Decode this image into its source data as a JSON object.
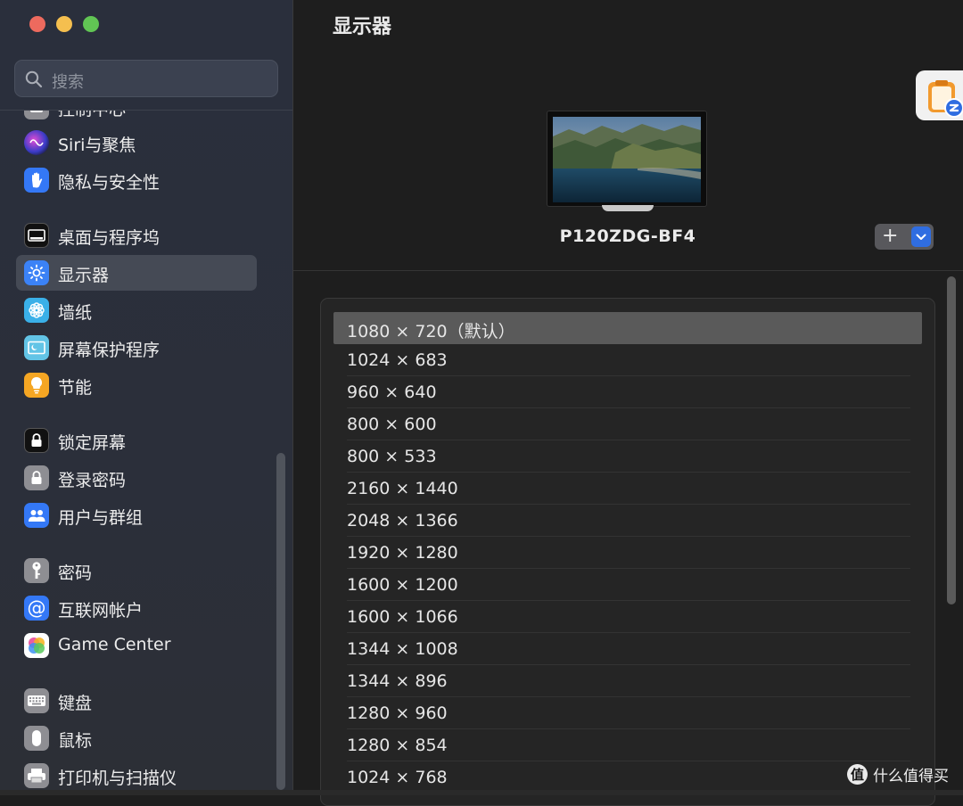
{
  "search": {
    "placeholder": "搜索"
  },
  "sidebar": {
    "items": [
      {
        "label": "控制中心",
        "icon": "control-center-icon"
      },
      {
        "label": "Siri与聚焦",
        "icon": "siri-icon"
      },
      {
        "label": "隐私与安全性",
        "icon": "hand-icon"
      },
      {
        "label": "桌面与程序坞",
        "icon": "dock-icon"
      },
      {
        "label": "显示器",
        "icon": "sun-icon",
        "selected": true
      },
      {
        "label": "墙纸",
        "icon": "flower-icon"
      },
      {
        "label": "屏幕保护程序",
        "icon": "screensaver-icon"
      },
      {
        "label": "节能",
        "icon": "lightbulb-icon"
      },
      {
        "label": "锁定屏幕",
        "icon": "lock-screen-icon"
      },
      {
        "label": "登录密码",
        "icon": "lock-icon"
      },
      {
        "label": "用户与群组",
        "icon": "users-icon"
      },
      {
        "label": "密码",
        "icon": "key-icon"
      },
      {
        "label": "互联网帐户",
        "icon": "at-icon"
      },
      {
        "label": "Game Center",
        "icon": "game-center-icon"
      },
      {
        "label": "键盘",
        "icon": "keyboard-icon"
      },
      {
        "label": "鼠标",
        "icon": "mouse-icon"
      },
      {
        "label": "打印机与扫描仪",
        "icon": "printer-icon"
      }
    ]
  },
  "main": {
    "title": "显示器",
    "display_name": "P120ZDG-BF4",
    "add_button": "+",
    "resolutions": [
      "1080 × 720（默认）",
      "1024 × 683",
      "960 × 640",
      "800 × 600",
      "800 × 533",
      "2160 × 1440",
      "2048 × 1366",
      "1920 × 1280",
      "1600 × 1200",
      "1600 × 1066",
      "1344 × 1008",
      "1344 × 896",
      "1280 × 960",
      "1280 × 854",
      "1024 × 768"
    ],
    "selected_resolution_index": 0
  },
  "watermark": {
    "logo": "值",
    "text": "什么值得买"
  },
  "colors": {
    "accent": "#2f6de1",
    "selected_row": "#5a5a5a"
  }
}
